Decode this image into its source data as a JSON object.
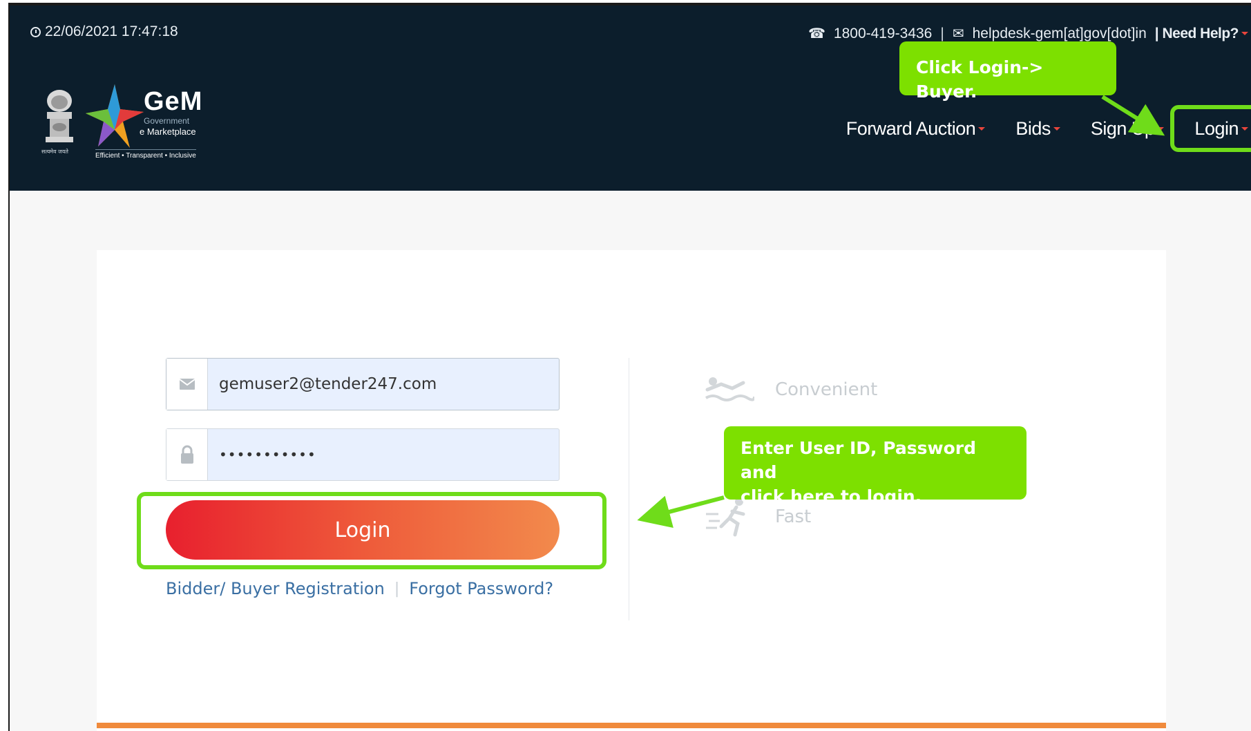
{
  "header": {
    "datetime": "22/06/2021 17:47:18",
    "phone": "1800-419-3436",
    "email": "helpdesk-gem[at]gov[dot]in",
    "help": "| Need Help?",
    "separator": "|"
  },
  "logo": {
    "title": "GeM",
    "subtitle_1": "Government",
    "subtitle_2": "e Marketplace",
    "tagline": "Efficient • Transparent • Inclusive",
    "emblem_caption": "सत्यमेव जयते"
  },
  "nav": {
    "items": [
      {
        "label": "Forward Auction"
      },
      {
        "label": "Bids"
      },
      {
        "label": "Sign Up"
      },
      {
        "label": "Login"
      }
    ]
  },
  "form": {
    "email_value": "gemuser2@tender247.com",
    "password_value": "•••••••••••",
    "login_label": "Login",
    "link_register": "Bidder/ Buyer Registration",
    "link_separator": "|",
    "link_forgot": "Forgot Password?"
  },
  "features": {
    "convenient": "Convenient",
    "fast": "Fast"
  },
  "annotations": {
    "top": "Click Login-> Buyer.",
    "mid_line1": "Enter User ID, Password and",
    "mid_line2": "click here to login."
  },
  "colors": {
    "header_bg": "#0c1e2c",
    "annotation_green": "#7de000",
    "login_gradient_start": "#e8202e",
    "login_gradient_end": "#f28a4c",
    "link_blue": "#3a6fa3",
    "card_bottom_orange": "#f08a3c"
  }
}
